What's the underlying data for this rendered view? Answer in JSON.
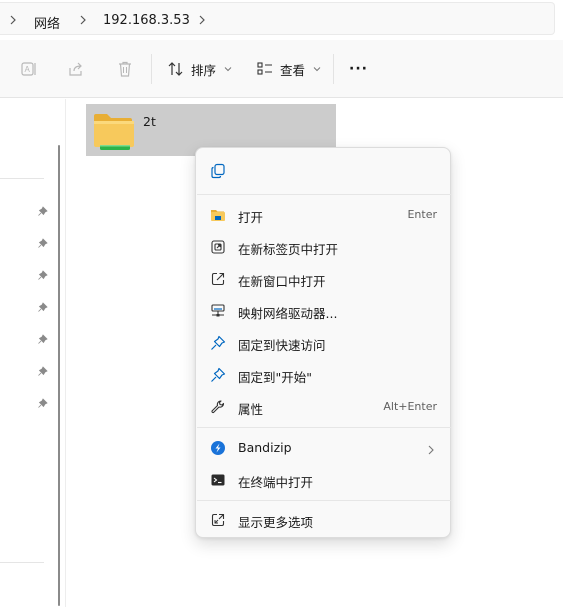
{
  "address_bar": {
    "crumbs": [
      "网络",
      "192.168.3.53"
    ]
  },
  "toolbar": {
    "sort_label": "排序",
    "view_label": "查看",
    "more_label": "···"
  },
  "content": {
    "folder_name": "2t"
  },
  "context_menu": {
    "items": [
      {
        "label": "打开",
        "shortcut": "Enter",
        "icon": "folder-open-icon"
      },
      {
        "label": "在新标签页中打开",
        "shortcut": "",
        "icon": "new-tab-icon"
      },
      {
        "label": "在新窗口中打开",
        "shortcut": "",
        "icon": "new-window-icon"
      },
      {
        "label": "映射网络驱动器...",
        "shortcut": "",
        "icon": "network-drive-icon"
      },
      {
        "label": "固定到快速访问",
        "shortcut": "",
        "icon": "pin-icon"
      },
      {
        "label": "固定到\"开始\"",
        "shortcut": "",
        "icon": "pin-start-icon"
      },
      {
        "label": "属性",
        "shortcut": "Alt+Enter",
        "icon": "wrench-icon"
      },
      {
        "label": "Bandizip",
        "shortcut": "",
        "icon": "bandizip-icon"
      },
      {
        "label": "在终端中打开",
        "shortcut": "",
        "icon": "terminal-icon"
      },
      {
        "label": "显示更多选项",
        "shortcut": "",
        "icon": "more-options-icon"
      }
    ]
  },
  "colors": {
    "accent": "#0067c0",
    "selection": "#cccccc",
    "folder_yellow": "#f7c95c",
    "network_green": "#2cb34a"
  }
}
